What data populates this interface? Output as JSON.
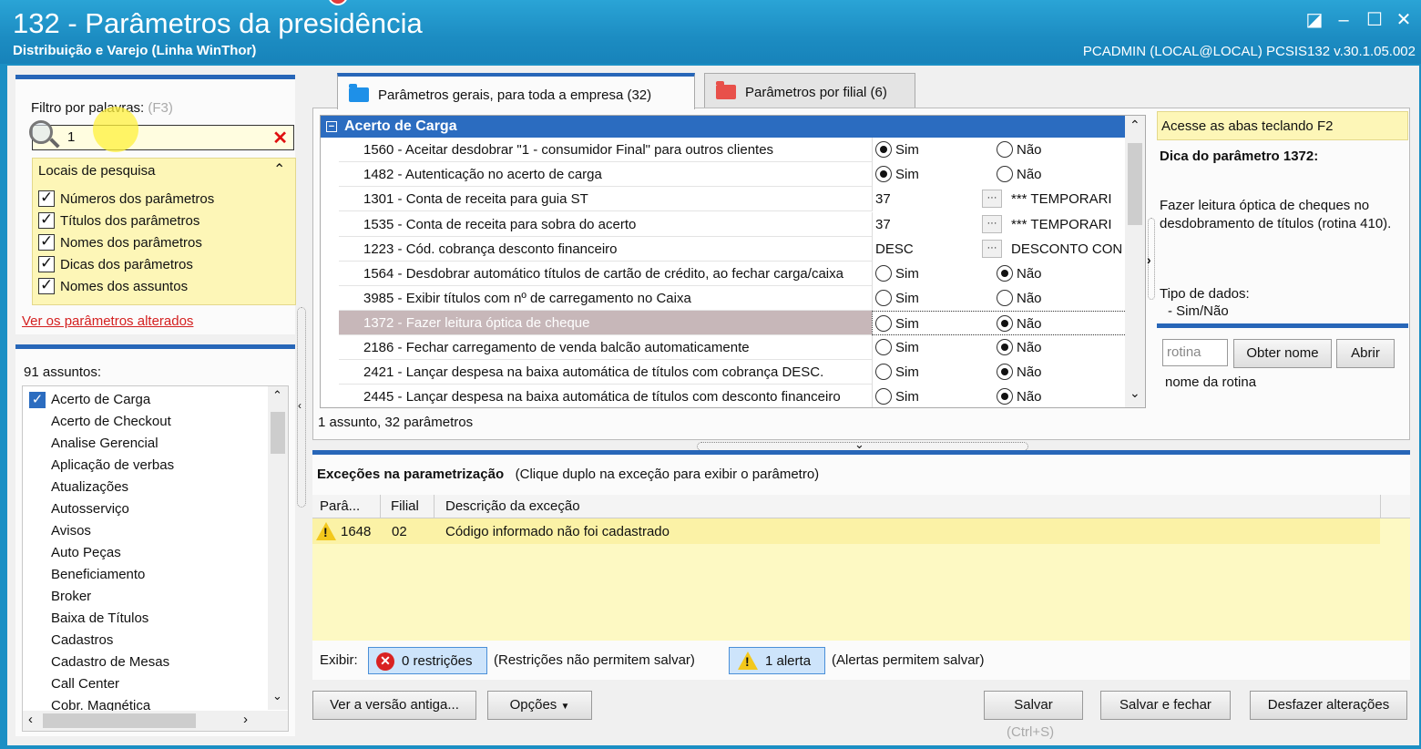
{
  "window": {
    "title": "132 - Parâmetros da presidência",
    "subtitle": "Distribuição e Varejo (Linha WinThor)",
    "userinfo": "PCADMIN (LOCAL@LOCAL)   PCSIS132  v.30.1.05.002"
  },
  "filter": {
    "label": "Filtro por palavras:",
    "shortcut": "(F3)",
    "value": "1",
    "locais_title": "Locais de pesquisa",
    "locais": [
      "Números dos parâmetros",
      "Títulos dos parâmetros",
      "Nomes dos parâmetros",
      "Dicas dos parâmetros",
      "Nomes dos assuntos"
    ],
    "changed_link": "Ver os parâmetros alterados"
  },
  "assuntos": {
    "count_label": "91 assuntos:",
    "items": [
      "Acerto de Carga",
      "Acerto de Checkout",
      "Analise Gerencial",
      "Aplicação de verbas",
      "Atualizações",
      "Autosserviço",
      "Avisos",
      "Auto Peças",
      "Beneficiamento",
      "Broker",
      "Baixa de Títulos",
      "Cadastros",
      "Cadastro de Mesas",
      "Call Center",
      "Cobr. Magnética"
    ]
  },
  "tabs": [
    {
      "label": "Parâmetros gerais, para toda a empresa (32)",
      "color": "#1e90e8"
    },
    {
      "label": "Parâmetros por filial (6)",
      "color": "#e8504a"
    }
  ],
  "grid": {
    "group": "Acerto de Carga",
    "rows": [
      {
        "name": "1560 - Aceitar desdobrar \"1 - consumidor Final\" para outros clientes",
        "type": "radio",
        "a": "Sim",
        "b": "Não",
        "sel": "a"
      },
      {
        "name": "1482 - Autenticação no acerto de carga",
        "type": "radio",
        "a": "Sim",
        "b": "Não",
        "sel": "a"
      },
      {
        "name": "1301 - Conta de receita para guia ST",
        "type": "lookup",
        "code": "37",
        "desc": "*** TEMPORARI"
      },
      {
        "name": "1535 - Conta de receita para sobra do acerto",
        "type": "lookup",
        "code": "37",
        "desc": "*** TEMPORARI"
      },
      {
        "name": "1223 - Cód. cobrança desconto financeiro",
        "type": "lookup",
        "code": "DESC",
        "desc": "DESCONTO CON"
      },
      {
        "name": "1564 - Desdobrar automático títulos de cartão de crédito, ao fechar carga/caixa",
        "type": "radio",
        "a": "Sim",
        "b": "Não",
        "sel": "b"
      },
      {
        "name": "3985 - Exibir títulos com nº de carregamento no Caixa",
        "type": "radio",
        "a": "Sim",
        "b": "Não",
        "sel": "none"
      },
      {
        "name": "1372 - Fazer leitura óptica de cheque",
        "type": "radio",
        "a": "Sim",
        "b": "Não",
        "sel": "b",
        "selected_row": true
      },
      {
        "name": "2186 - Fechar carregamento de venda balcão automaticamente",
        "type": "radio",
        "a": "Sim",
        "b": "Não",
        "sel": "b"
      },
      {
        "name": "2421 - Lançar despesa na baixa automática de títulos com cobrança DESC.",
        "type": "radio",
        "a": "Sim",
        "b": "Não",
        "sel": "b"
      },
      {
        "name": "2445 - Lançar despesa na baixa automática de títulos com desconto financeiro",
        "type": "radio",
        "a": "Sim",
        "b": "Não",
        "sel": "b"
      }
    ],
    "status": "1 assunto, 32 parâmetros"
  },
  "tip": {
    "hint": "Acesse as abas teclando F2",
    "title": "Dica do parâmetro 1372:",
    "text": "Fazer leitura óptica de cheques no desdobramento de títulos (rotina 410).",
    "tipo_label": "Tipo de dados:",
    "tipo_value": "- Sim/Não",
    "rotina_placeholder": "rotina",
    "obter_label": "Obter nome",
    "abrir_label": "Abrir",
    "nome_rotina": "nome da rotina"
  },
  "exceptions": {
    "title": "Exceções na parametrização",
    "hint": "(Clique duplo na exceção para exibir o parâmetro)",
    "headers": [
      "Parâ...",
      "Filial",
      "Descrição da exceção"
    ],
    "rows": [
      {
        "param": "1648",
        "filial": "02",
        "desc": "Código informado não foi cadastrado"
      }
    ],
    "exibir_label": "Exibir:",
    "restricoes": "0 restrições",
    "restricoes_note": "(Restrições não permitem salvar)",
    "alertas": "1 alerta",
    "alertas_note": "(Alertas permitem salvar)"
  },
  "footer": {
    "ver_versao": "Ver a versão antiga...",
    "opcoes": "Opções",
    "salvar": "Salvar",
    "salvar_shortcut": "(Ctrl+S)",
    "salvar_fechar": "Salvar e fechar",
    "desfazer": "Desfazer alterações"
  }
}
